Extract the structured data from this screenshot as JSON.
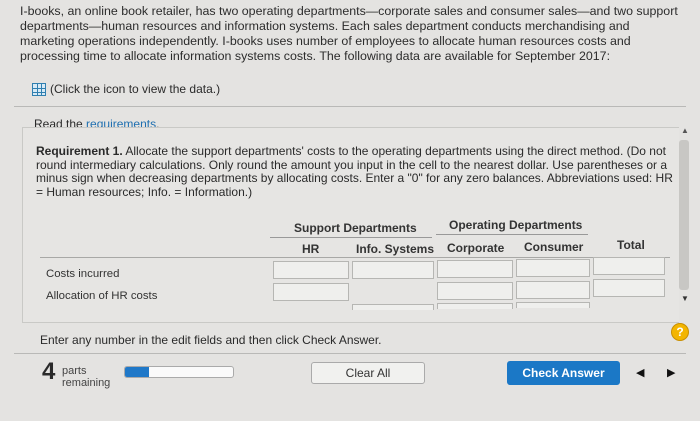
{
  "intro": {
    "text": "I-books, an online book retailer, has two operating departments—corporate sales and consumer sales—and two support departments—human resources and information systems. Each sales department conducts merchandising and marketing operations independently. I-books uses number of employees to allocate human resources costs and processing time to allocate information systems costs. The following data are available for September 2017:",
    "data_link": "(Click the icon to view the data.)",
    "data_icon": "table-grid-icon"
  },
  "read_requirements": {
    "prefix": "Read the ",
    "link": "requirements",
    "suffix": "."
  },
  "requirement": {
    "heading": "Requirement 1.",
    "text": " Allocate the support departments' costs to the operating departments using the direct method. (Do not round intermediary calculations. Only round the amount you input in the cell to the nearest dollar. Use parentheses or a minus sign when decreasing departments by allocating costs. Enter a \"0\" for any zero balances. Abbreviations used: HR = Human resources; Info. = Information.)"
  },
  "table": {
    "group_headers": [
      "Support Departments",
      "Operating Departments"
    ],
    "columns": [
      "HR",
      "Info. Systems",
      "Corporate",
      "Consumer",
      "Total"
    ],
    "rows": [
      {
        "label": "Costs incurred",
        "values": [
          "",
          "",
          "",
          "",
          ""
        ]
      },
      {
        "label": "Allocation of HR costs",
        "values": [
          "",
          "",
          "",
          ""
        ]
      }
    ]
  },
  "instruction": "Enter any number in the edit fields and then click Check Answer.",
  "help_label": "?",
  "footer": {
    "parts_count": "4",
    "parts_label_1": "parts",
    "parts_label_2": "remaining",
    "progress_fraction": 0.22,
    "clear_label": "Clear All",
    "check_label": "Check Answer",
    "prev_icon": "triangle-left-icon",
    "next_icon": "triangle-right-icon"
  }
}
